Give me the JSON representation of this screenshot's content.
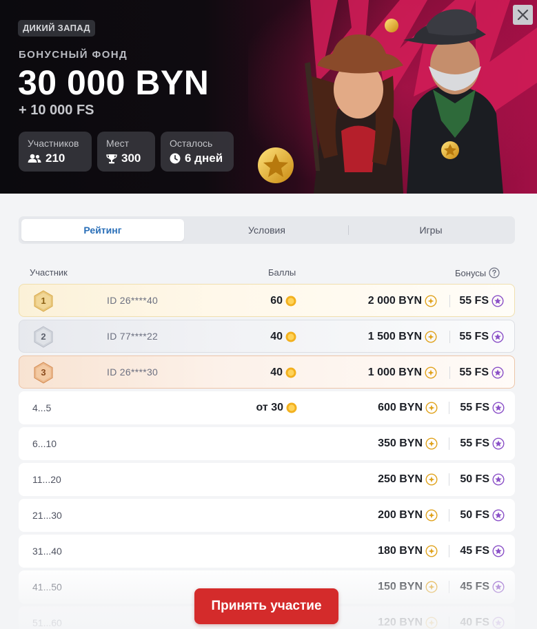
{
  "hero": {
    "tag": "ДИКИЙ ЗАПАД",
    "subtitle": "БОНУСНЫЙ ФОНД",
    "amount": "30 000 BYN",
    "extra": "+ 10 000 FS",
    "stats": [
      {
        "label": "Участников",
        "value": "210",
        "icon": "users-icon"
      },
      {
        "label": "Мест",
        "value": "300",
        "icon": "trophy-icon"
      },
      {
        "label": "Осталось",
        "value": "6 дней",
        "icon": "clock-icon"
      }
    ]
  },
  "tabs": [
    {
      "label": "Рейтинг",
      "active": true
    },
    {
      "label": "Условия",
      "active": false
    },
    {
      "label": "Игры",
      "active": false
    }
  ],
  "table": {
    "headers": {
      "participant": "Участник",
      "points": "Баллы",
      "bonuses": "Бонусы"
    },
    "rows": [
      {
        "rank": "1",
        "id": "ID 26****40",
        "points": "60",
        "sum": "2 000 BYN",
        "fs": "55 FS"
      },
      {
        "rank": "2",
        "id": "ID 77****22",
        "points": "40",
        "sum": "1 500 BYN",
        "fs": "55 FS"
      },
      {
        "rank": "3",
        "id": "ID 26****30",
        "points": "40",
        "sum": "1 000 BYN",
        "fs": "55 FS"
      },
      {
        "place": "4...5",
        "points": "от 30",
        "sum": "600 BYN",
        "fs": "55 FS"
      },
      {
        "place": "6...10",
        "sum": "350 BYN",
        "fs": "55 FS"
      },
      {
        "place": "11...20",
        "sum": "250 BYN",
        "fs": "50 FS"
      },
      {
        "place": "21...30",
        "sum": "200 BYN",
        "fs": "50 FS"
      },
      {
        "place": "31...40",
        "sum": "180 BYN",
        "fs": "45 FS"
      },
      {
        "place": "41...50",
        "sum": "150 BYN",
        "fs": "45 FS"
      },
      {
        "place": "51...60",
        "sum": "120 BYN",
        "fs": "40 FS"
      }
    ]
  },
  "cta": {
    "label": "Принять участие"
  },
  "colors": {
    "accent": "#2a6fb8",
    "cta": "#d42b2b",
    "coin": "#f2b01e",
    "fs_badge": "#8a4fc7",
    "gold": "#d8a94a",
    "silver": "#b7bcc6",
    "bronze": "#d38a4f"
  }
}
